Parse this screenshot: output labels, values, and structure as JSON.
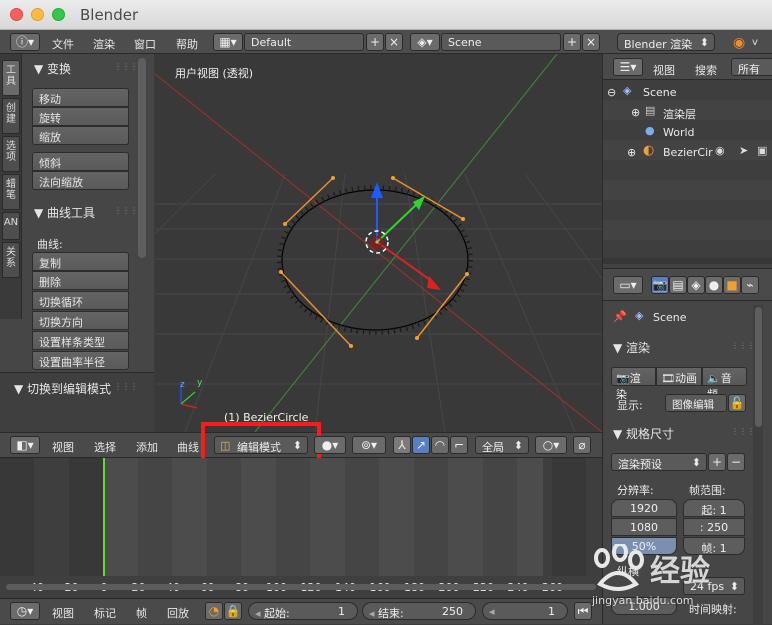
{
  "window": {
    "title": "Blender"
  },
  "info_header": {
    "menus": [
      "文件",
      "渲染",
      "窗口",
      "帮助"
    ],
    "layout": "Default",
    "scene": "Scene",
    "engine": "Blender 渲染"
  },
  "tool_shelf": {
    "tabs": [
      "工具",
      "创建",
      "选项",
      "蜡笔",
      "AN",
      "关系"
    ],
    "transform": {
      "title": "变换",
      "buttons": [
        "移动",
        "旋转",
        "缩放",
        "倾斜",
        "法向缩放"
      ]
    },
    "curve_tools": {
      "title": "曲线工具",
      "label": "曲线:",
      "buttons": [
        "复制",
        "删除",
        "切换循环",
        "切换方向",
        "设置样条类型",
        "设置曲率半径"
      ]
    },
    "operator": {
      "title": "切换到编辑模式"
    }
  },
  "viewport": {
    "view_label": "用户视图 (透视)",
    "object_label": "(1) BezierCircle"
  },
  "viewport_header": {
    "menus": [
      "视图",
      "选择",
      "添加",
      "曲线"
    ],
    "mode": "编辑模式",
    "orientation": "全局"
  },
  "timeline": {
    "ticks": [
      "-40",
      "-20",
      "0",
      "20",
      "40",
      "60",
      "80",
      "100",
      "120",
      "140",
      "160",
      "180",
      "200",
      "220",
      "240",
      "260"
    ],
    "current_frame": "1"
  },
  "bottom_bar": {
    "menus": [
      "视图",
      "标记",
      "帧",
      "回放"
    ],
    "start_label": "起始:",
    "start": "1",
    "end_label": "结束:",
    "end": "250",
    "current": "1"
  },
  "outliner": {
    "view": "视图",
    "search": "搜索",
    "filter": "所有场",
    "items": [
      "Scene",
      "渲染层",
      "World",
      "BezierCirc"
    ]
  },
  "properties": {
    "scene": "Scene",
    "render_title": "渲染",
    "render_btn": "渲染",
    "anim_btn": "动画",
    "audio_btn": "音频",
    "display_label": "显示:",
    "display_value": "图像编辑",
    "dims_title": "规格尺寸",
    "preset": "渲染预设",
    "resolution_label": "分辨率:",
    "res_x": "1920",
    "res_y": "1080",
    "res_pct": "50%",
    "frame_range_label": "帧范围:",
    "frame_start": "起:   1",
    "frame_end": ": 250",
    "frame_step": "帧:   1",
    "aspect_label": "纵横",
    "fps": "24 fps",
    "aspect_x": "1.000",
    "time_label": "时间映射:"
  },
  "watermark": {
    "text": "经验",
    "sub": "jingyan.baidu.com"
  },
  "colors": {
    "highlight": "#ff1a1a",
    "accent": "#5680c2",
    "active": "#f0f0f0"
  }
}
